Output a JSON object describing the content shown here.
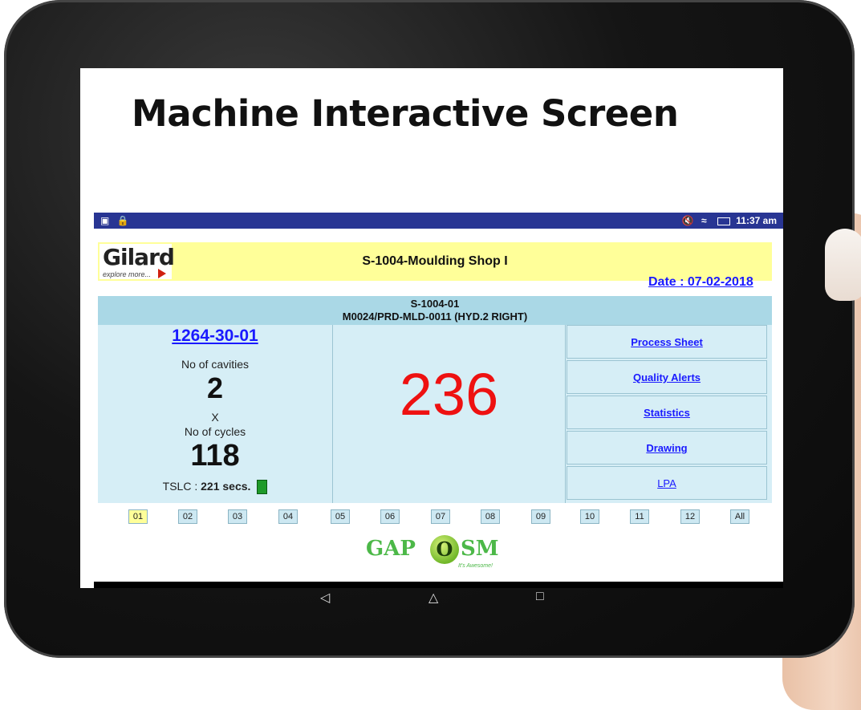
{
  "page": {
    "title": "Machine Interactive Screen"
  },
  "status_bar": {
    "left_icons": [
      "image-icon",
      "lock-icon"
    ],
    "time": "11:37 am",
    "right_icons": [
      "mute-icon",
      "wifi-icon",
      "battery-icon"
    ]
  },
  "header": {
    "logo_text": "Gilard",
    "logo_tagline": "explore more...",
    "shop_name": "S-1004-Moulding Shop I",
    "date": "Date : 07-02-2018"
  },
  "machine": {
    "code": "S-1004-01",
    "description": "M0024/PRD-MLD-0011 (HYD.2 RIGHT)"
  },
  "left": {
    "part_no": "1264-30-01",
    "cavities_label": "No of cavities",
    "cavities": "2",
    "times": "X",
    "cycles_label": "No of cycles",
    "cycles": "118",
    "tslc_label": "TSLC : ",
    "tslc_value": "221 secs.",
    "status_color": "#1e9a2a"
  },
  "count": "236",
  "links": [
    "Process Sheet",
    "Quality Alerts",
    "Statistics",
    "Drawing",
    "LPA"
  ],
  "pages": [
    "01",
    "02",
    "03",
    "04",
    "05",
    "06",
    "07",
    "08",
    "09",
    "10",
    "11",
    "12",
    "All"
  ],
  "selected_page": "01",
  "footer_logo": {
    "left": "GAP",
    "o": "O",
    "right": "SM",
    "tagline": "It's Awesome!"
  },
  "nav_keys": {
    "back": "◁",
    "home": "△",
    "recents": "□"
  }
}
